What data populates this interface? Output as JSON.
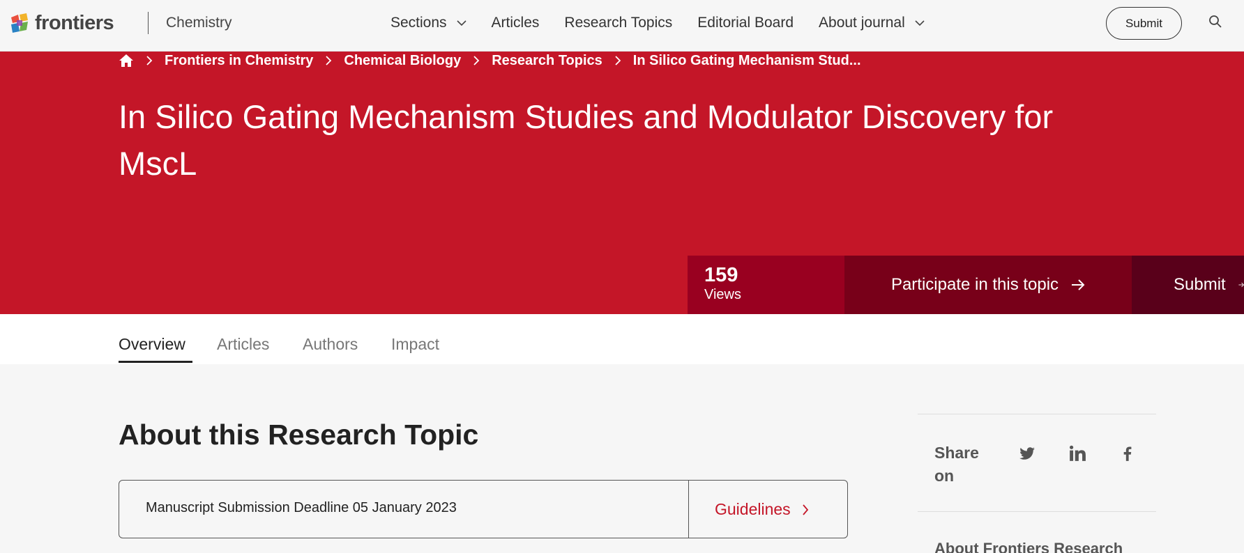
{
  "header": {
    "logo_text": "frontiers",
    "journal": "Chemistry",
    "nav": [
      {
        "label": "Sections",
        "dropdown": true
      },
      {
        "label": "Articles",
        "dropdown": false
      },
      {
        "label": "Research Topics",
        "dropdown": false
      },
      {
        "label": "Editorial Board",
        "dropdown": false
      },
      {
        "label": "About journal",
        "dropdown": true
      }
    ],
    "submit_label": "Submit",
    "search_icon": "search-icon"
  },
  "breadcrumb": {
    "home_icon": "home-icon",
    "items": [
      "Frontiers in Chemistry",
      "Chemical Biology",
      "Research Topics",
      "In Silico Gating Mechanism Stud..."
    ]
  },
  "hero": {
    "title": "In Silico Gating Mechanism Studies and Modulator Discovery for MscL",
    "views_count": "159",
    "views_label": "Views",
    "participate_label": "Participate in this topic",
    "submit_label": "Submit"
  },
  "tabs": [
    {
      "label": "Overview",
      "active": true
    },
    {
      "label": "Articles",
      "active": false
    },
    {
      "label": "Authors",
      "active": false
    },
    {
      "label": "Impact",
      "active": false
    }
  ],
  "main": {
    "section_title": "About this Research Topic",
    "deadline_text": "Manuscript Submission Deadline 05 January 2023",
    "guidelines_label": "Guidelines"
  },
  "sidebar": {
    "share_label": "Share on",
    "share_icons": [
      "twitter-icon",
      "linkedin-icon",
      "facebook-icon"
    ],
    "about_label": "About Frontiers Research"
  },
  "colors": {
    "brand_red": "#c41628",
    "views_bg": "#990020",
    "participate_bg": "#780019",
    "submit_bg": "#59001a",
    "page_bg": "#f6f6f6"
  }
}
